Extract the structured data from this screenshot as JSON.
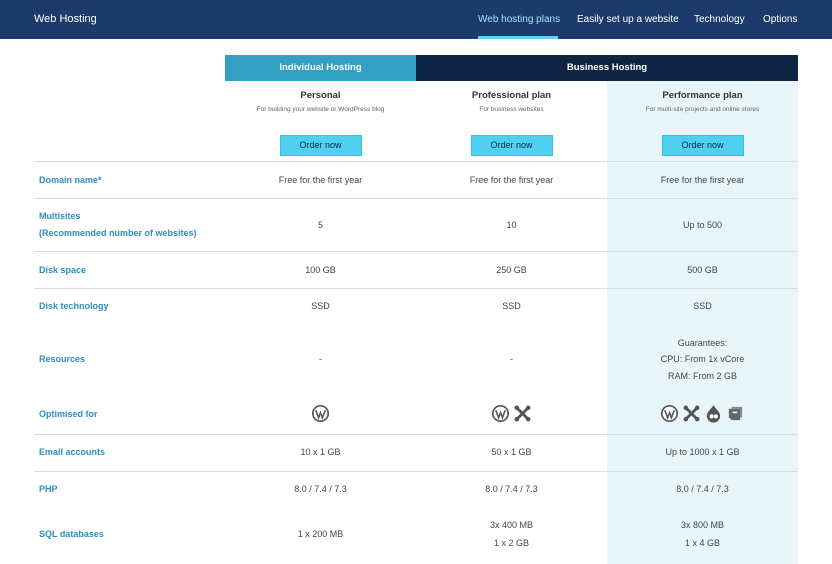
{
  "nav": {
    "brand": "Web Hosting",
    "links": [
      {
        "label": "Web hosting plans",
        "active": true
      },
      {
        "label": "Easily set up a website",
        "active": false
      },
      {
        "label": "Technology",
        "active": false
      },
      {
        "label": "Options",
        "active": false
      }
    ]
  },
  "groups": {
    "individual": "Individual Hosting",
    "business": "Business Hosting"
  },
  "plans": [
    {
      "name": "Personal",
      "desc": "For building your website or WordPress blog",
      "cta": "Order now"
    },
    {
      "name": "Professional plan",
      "desc": "For business websites",
      "cta": "Order now"
    },
    {
      "name": "Performance plan",
      "desc": "For multi-site projects and online stores",
      "cta": "Order now"
    }
  ],
  "rows": {
    "domain": {
      "label": "Domain name*",
      "values": [
        "Free for the first year",
        "Free for the first year",
        "Free for the first year"
      ]
    },
    "multisites": {
      "label_line1": "Multisites",
      "label_line2": "(Recommended number of websites)",
      "values": [
        "5",
        "10",
        "Up to 500"
      ]
    },
    "disk_space": {
      "label": "Disk space",
      "values": [
        "100 GB",
        "250 GB",
        "500 GB"
      ]
    },
    "disk_tech": {
      "label": "Disk technology",
      "values": [
        "SSD",
        "SSD",
        "SSD"
      ]
    },
    "resources": {
      "label": "Resources",
      "values": [
        "-",
        "-"
      ],
      "perf_lines": [
        "Guarantees:",
        "CPU: From 1x vCore",
        "RAM: From 2 GB"
      ]
    },
    "optimised": {
      "label": "Optimised for",
      "icons": [
        [
          "wordpress-icon"
        ],
        [
          "wordpress-icon",
          "joomla-icon"
        ],
        [
          "wordpress-icon",
          "joomla-icon",
          "drupal-icon",
          "prestashop-icon"
        ]
      ]
    },
    "email": {
      "label": "Email accounts",
      "values": [
        "10 x 1 GB",
        "50 x 1 GB",
        "Up to 1000 x 1 GB"
      ]
    },
    "php": {
      "label": "PHP",
      "values": [
        "8.0 / 7.4 / 7.3",
        "8.0 / 7.4 / 7.3",
        "8.0 / 7.4 / 7.3"
      ]
    },
    "sql": {
      "label": "SQL databases",
      "personal": "1 x 200 MB",
      "pro_lines": [
        "3x 400 MB",
        "1 x 2 GB"
      ],
      "perf_lines": [
        "3x 800 MB",
        "1 x 4 GB"
      ]
    }
  },
  "colors": {
    "nav_bg": "#1c3b6b",
    "individual_header": "#31a0c2",
    "business_header": "#0f2544",
    "accent": "#4fd0f0",
    "label": "#2b8fbf",
    "highlight_col": "#e8f6fc"
  }
}
